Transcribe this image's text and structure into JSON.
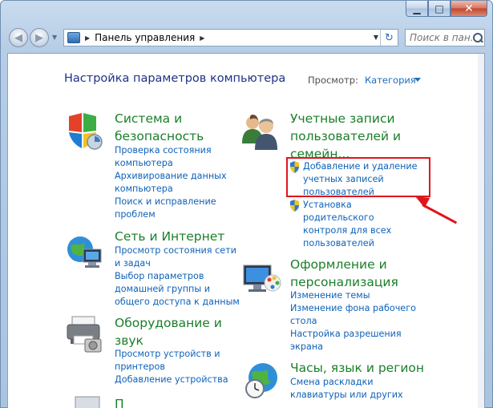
{
  "window": {
    "caption_buttons": [
      "minimize-icon",
      "maximize-icon",
      "close-icon"
    ]
  },
  "nav": {
    "address_text": "Панель управления",
    "search_placeholder": "Поиск в пан..."
  },
  "header": {
    "title": "Настройка параметров компьютера",
    "view_label": "Просмотр:",
    "view_value": "Категория"
  },
  "categories": [
    {
      "icon": "security-shield-icon",
      "title_lines": [
        "Система и",
        "безопасность"
      ],
      "tasks": [
        "Проверка состояния",
        "компьютера",
        "Архивирование данных",
        "компьютера",
        "Поиск и исправление",
        "проблем"
      ]
    },
    {
      "icon": "network-globe-icon",
      "title_lines": [
        "Сеть и Интернет"
      ],
      "tasks": [
        "Просмотр состояния сети",
        "и задач",
        "Выбор параметров",
        "домашней группы и",
        "общего доступа к данным"
      ]
    },
    {
      "icon": "printer-icon",
      "title_lines": [
        "Оборудование и",
        "звук"
      ],
      "tasks": [
        "Просмотр устройств и",
        "принтеров",
        "Добавление устройства"
      ]
    },
    {
      "icon": "users-icon",
      "title_lines": [
        "Учетные записи",
        "пользователей и",
        "семейн..."
      ],
      "tasks": [
        "Добавление и удаление",
        "учетных записей",
        "пользователей",
        "Установка",
        "родительского",
        "контроля для всех",
        "пользователей"
      ]
    },
    {
      "icon": "monitor-palette-icon",
      "title_lines": [
        "Оформление и",
        "персонализация"
      ],
      "tasks": [
        "Изменение темы",
        "Изменение фона рабочего",
        "стола",
        "Настройка разрешения",
        "экрана"
      ]
    },
    {
      "icon": "clock-globe-icon",
      "title_lines": [
        "Часы, язык и регион"
      ],
      "tasks": [
        "Смена раскладки",
        "клавиатуры или других"
      ]
    }
  ],
  "annotation": {
    "color": "#e0151d"
  }
}
